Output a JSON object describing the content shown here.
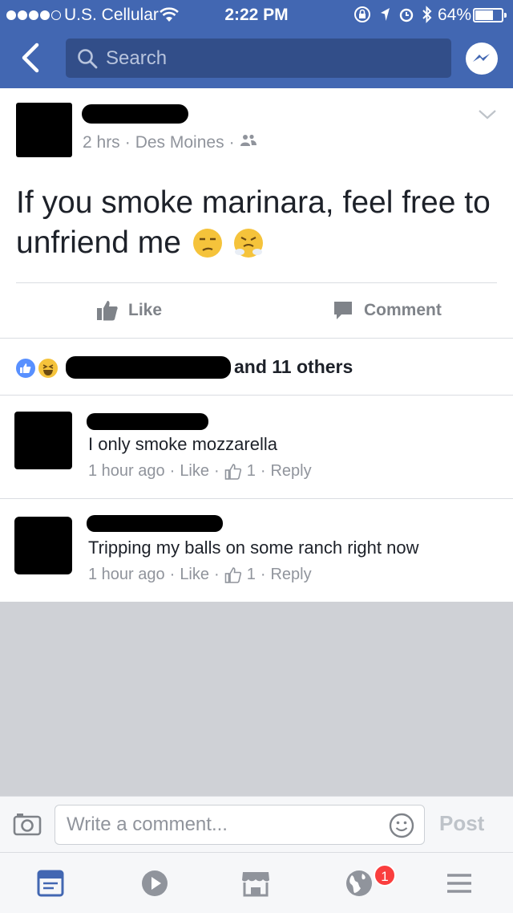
{
  "status_bar": {
    "carrier": "U.S. Cellular",
    "time": "2:22 PM",
    "battery": "64%",
    "battery_level": 0.64
  },
  "header": {
    "search_placeholder": "Search",
    "back_icon": "chevron-left-icon",
    "messenger_icon": "messenger-icon"
  },
  "post": {
    "time": "2 hrs",
    "location": "Des Moines",
    "audience_icon": "friends-icon",
    "text": "If you smoke marinara, feel free to unfriend me",
    "emojis": [
      "unamused-face",
      "face-with-steam-from-nose"
    ]
  },
  "actions": {
    "like_label": "Like",
    "comment_label": "Comment"
  },
  "reactions": {
    "others_text": "and 11 others",
    "icons": [
      "like-reaction",
      "haha-reaction"
    ]
  },
  "comments": [
    {
      "text": "I only smoke mozzarella",
      "time": "1 hour ago",
      "like": "Like",
      "likes": "1",
      "reply": "Reply"
    },
    {
      "text": "Tripping my balls on some ranch right now",
      "time": "1 hour ago",
      "like": "Like",
      "likes": "1",
      "reply": "Reply"
    }
  ],
  "composer": {
    "placeholder": "Write a comment...",
    "post_label": "Post"
  },
  "tabbar": {
    "notifications_badge": "1",
    "tabs": [
      "news-feed-icon",
      "video-icon",
      "marketplace-icon",
      "notifications-globe-icon",
      "menu-icon"
    ]
  },
  "colors": {
    "brand_blue": "#4267b2",
    "search_bg": "#324e89",
    "secondary_text": "#90949c",
    "badge_red": "#fa3e3e"
  }
}
